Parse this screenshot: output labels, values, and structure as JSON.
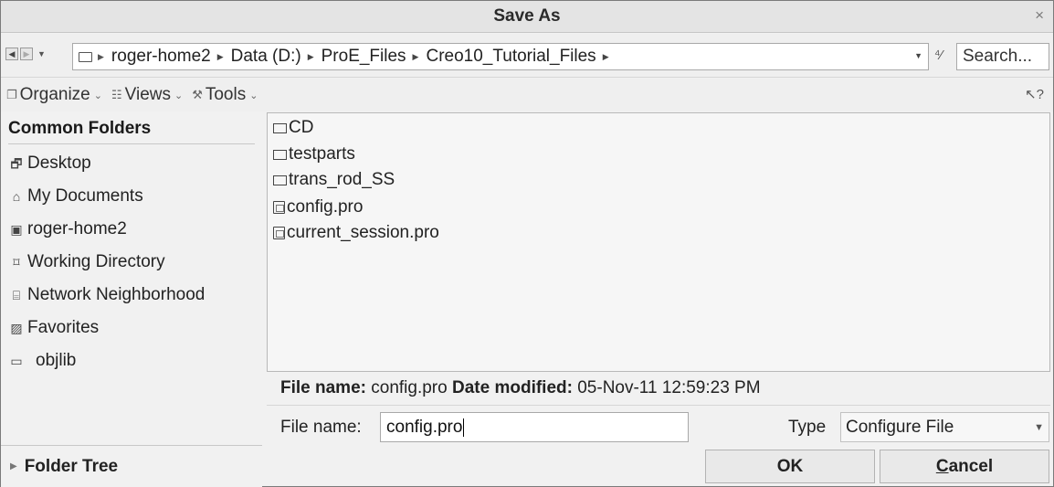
{
  "window": {
    "title": "Save As",
    "close_glyph": "×"
  },
  "address_bar": {
    "path": [
      "roger-home2",
      "Data (D:)",
      "ProE_Files",
      "Creo10_Tutorial_Files"
    ],
    "search_placeholder": "Search..."
  },
  "toolbar": {
    "items": [
      {
        "label": "Organize",
        "icon": "organize-icon"
      },
      {
        "label": "Views",
        "icon": "views-icon"
      },
      {
        "label": "Tools",
        "icon": "tools-icon"
      }
    ]
  },
  "sidebar": {
    "header": "Common Folders",
    "items": [
      {
        "label": "Desktop",
        "icon": "desktop-icon"
      },
      {
        "label": "My Documents",
        "icon": "my-documents-icon"
      },
      {
        "label": "roger-home2",
        "icon": "computer-icon"
      },
      {
        "label": "Working Directory",
        "icon": "working-directory-icon"
      },
      {
        "label": "Network Neighborhood",
        "icon": "network-icon"
      },
      {
        "label": "Favorites",
        "icon": "favorites-icon"
      },
      {
        "label": "objlib",
        "icon": "folder-icon"
      }
    ],
    "folder_tree_label": "Folder Tree"
  },
  "files": [
    {
      "name": "CD",
      "type": "folder"
    },
    {
      "name": "testparts",
      "type": "folder"
    },
    {
      "name": "trans_rod_SS",
      "type": "folder"
    },
    {
      "name": "config.pro",
      "type": "file"
    },
    {
      "name": "current_session.pro",
      "type": "file"
    }
  ],
  "info": {
    "file_name_label": "File name:",
    "file_name": "config.pro",
    "date_label": "Date modified:",
    "date": "05-Nov-11 12:59:23 PM"
  },
  "form": {
    "file_name_label": "File name:",
    "file_name_value": "config.pro",
    "type_label": "Type",
    "type_value": "Configure File"
  },
  "buttons": {
    "ok": "OK",
    "cancel_underlined": "C",
    "cancel_rest": "ancel"
  }
}
